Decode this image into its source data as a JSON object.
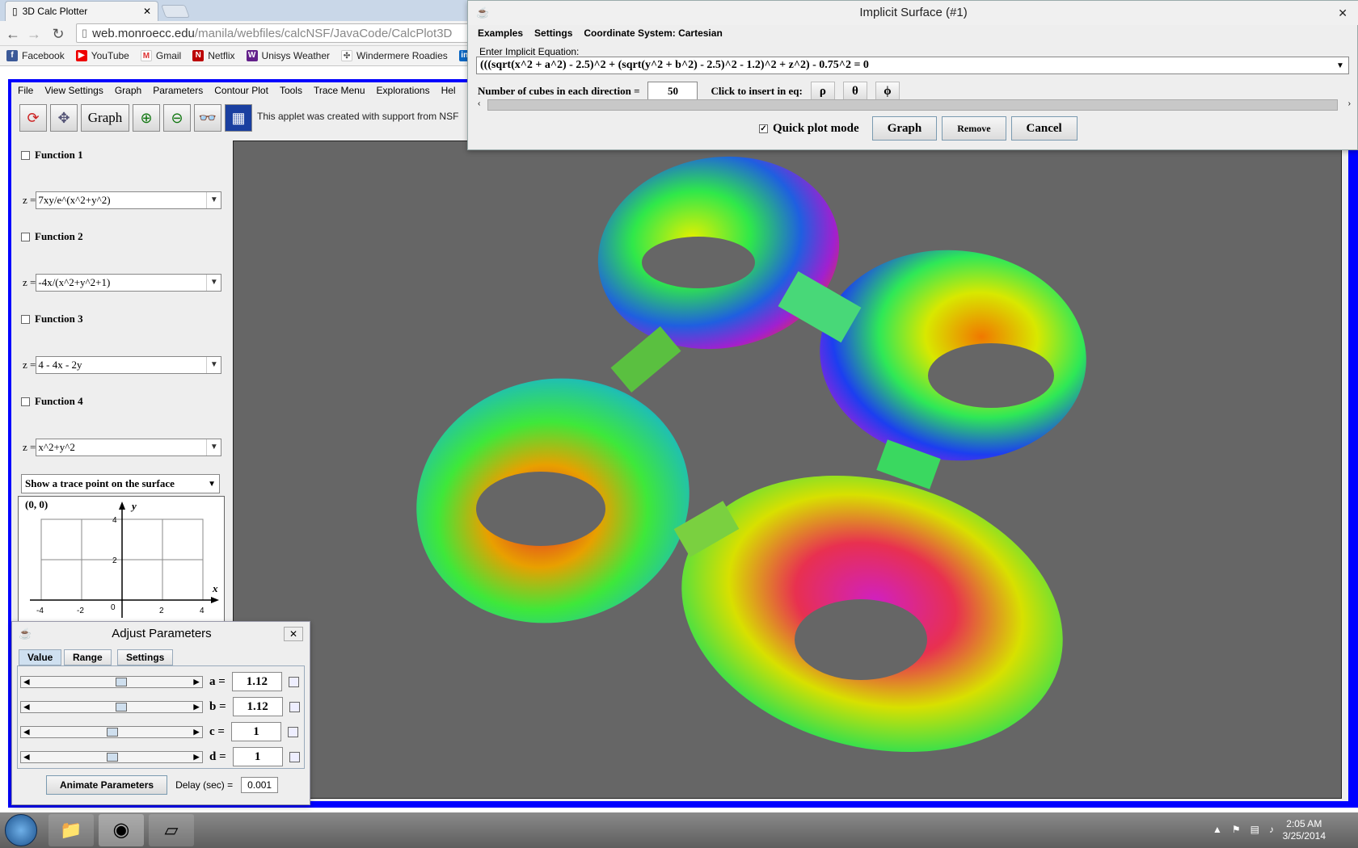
{
  "browser": {
    "tab_title": "3D Calc Plotter",
    "url_domain": "web.monroecc.edu",
    "url_path": "/manila/webfiles/calcNSF/JavaCode/CalcPlot3D",
    "bookmarks": [
      "Facebook",
      "YouTube",
      "Gmail",
      "Netflix",
      "Unisys Weather",
      "Windermere Roadies"
    ]
  },
  "applet": {
    "menu": [
      "File",
      "View Settings",
      "Graph",
      "Parameters",
      "Contour Plot",
      "Tools",
      "Trace Menu",
      "Explorations",
      "Hel"
    ],
    "graph_button": "Graph",
    "nsf_text": "This applet was created with support from NSF",
    "functions": [
      {
        "label": "Function 1",
        "z_label": "z =",
        "expr": "7xy/e^(x^2+y^2)"
      },
      {
        "label": "Function 2",
        "z_label": "z =",
        "expr": "-4x/(x^2+y^2+1)"
      },
      {
        "label": "Function 3",
        "z_label": "z =",
        "expr": "4 - 4x - 2y"
      },
      {
        "label": "Function 4",
        "z_label": "z =",
        "expr": "x^2+y^2"
      }
    ],
    "trace_select": "Show a trace point on the surface",
    "mini_graph": {
      "point": "(0, 0)",
      "x_label": "x",
      "y_label": "y",
      "x_ticks": [
        "-4",
        "-2",
        "0",
        "2",
        "4"
      ],
      "y_ticks": [
        "4",
        "2"
      ]
    }
  },
  "implicit_dialog": {
    "title": "Implicit Surface (#1)",
    "menu": [
      "Examples",
      "Settings",
      "Coordinate System: Cartesian"
    ],
    "eq_label": "Enter Implicit Equation:",
    "equation": "(((sqrt(x^2 + a^2) - 2.5)^2 + (sqrt(y^2 + b^2) - 2.5)^2 - 1.2)^2 + z^2) - 0.75^2 = 0",
    "cubes_label": "Number of cubes in each direction =",
    "cubes_value": "50",
    "insert_label": "Click to insert in eq:",
    "greek": [
      "ρ",
      "θ",
      "ϕ"
    ],
    "quick_plot_label": "Quick plot mode",
    "quick_plot_checked": true,
    "buttons": {
      "graph": "Graph",
      "remove": "Remove",
      "cancel": "Cancel"
    }
  },
  "adjust_params": {
    "title": "Adjust Parameters",
    "tabs": [
      "Value",
      "Range",
      "Settings"
    ],
    "params": [
      {
        "name": "a =",
        "value": "1.12",
        "level": 0.56
      },
      {
        "name": "b =",
        "value": "1.12",
        "level": 0.56
      },
      {
        "name": "c =",
        "value": "1",
        "level": 0.5
      },
      {
        "name": "d =",
        "value": "1",
        "level": 0.5
      }
    ],
    "animate_label": "Animate Parameters",
    "delay_label": "Delay (sec) =",
    "delay_value": "0.001"
  },
  "taskbar": {
    "time": "2:05 AM",
    "date": "3/25/2014"
  },
  "colors": {
    "applet_border": "#0000ff",
    "canvas_bg": "#666666"
  }
}
